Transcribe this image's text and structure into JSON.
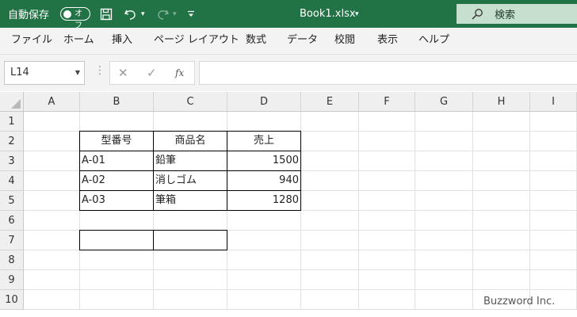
{
  "titlebar": {
    "autosave_label": "自動保存",
    "toggle_state": "オフ",
    "doc_title": "Book1.xlsx",
    "search_label": "検索",
    "bg_color": "#217346"
  },
  "ribbon": {
    "tabs": [
      "ファイル",
      "ホーム",
      "挿入",
      "ページ レイアウト",
      "数式",
      "データ",
      "校閲",
      "表示",
      "ヘルプ"
    ]
  },
  "formula_bar": {
    "name_box": "L14",
    "fx_label": "fx",
    "formula": ""
  },
  "sheet": {
    "columns": [
      "A",
      "B",
      "C",
      "D",
      "E",
      "F",
      "G",
      "H",
      "I"
    ],
    "rows": [
      "1",
      "2",
      "3",
      "4",
      "5",
      "6",
      "7",
      "8",
      "9",
      "10"
    ],
    "cells": {
      "B2": "型番号",
      "C2": "商品名",
      "D2": "売上",
      "B3": "A-01",
      "C3": "鉛筆",
      "D3": "1500",
      "B4": "A-02",
      "C4": "消しゴム",
      "D4": "940",
      "B5": "A-03",
      "C5": "筆箱",
      "D5": "1280"
    }
  },
  "watermark": "Buzzword Inc."
}
